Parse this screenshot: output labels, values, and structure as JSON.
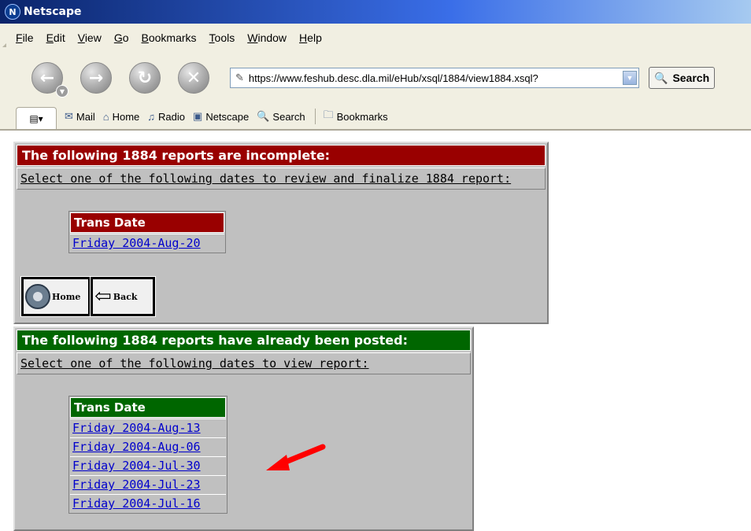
{
  "window": {
    "title": "Netscape",
    "app_icon": "N"
  },
  "menu": [
    "File",
    "Edit",
    "View",
    "Go",
    "Bookmarks",
    "Tools",
    "Window",
    "Help"
  ],
  "navbar": {
    "url": "https://www.feshub.desc.dla.mil/eHub/xsql/1884/view1884.xsql?",
    "search_label": "Search"
  },
  "personal_toolbar": {
    "items": [
      "Mail",
      "Home",
      "Radio",
      "Netscape",
      "Search",
      "Bookmarks"
    ]
  },
  "incomplete": {
    "heading": "The following 1884 reports are incomplete:",
    "instruction": "Select one of the following dates to review and finalize 1884 report:",
    "table_header": "Trans Date",
    "dates": [
      "Friday 2004-Aug-20"
    ],
    "buttons": {
      "home": "Home",
      "back": "Back"
    }
  },
  "posted": {
    "heading": "The following 1884 reports have already been posted:",
    "instruction": "Select one of the following dates to view report:",
    "table_header": "Trans Date",
    "dates": [
      "Friday 2004-Aug-13",
      "Friday 2004-Aug-06",
      "Friday 2004-Jul-30",
      "Friday 2004-Jul-23",
      "Friday 2004-Jul-16"
    ]
  },
  "colors": {
    "incomplete_header": "#990000",
    "posted_header": "#006600",
    "link": "#0000cc",
    "annotation_arrow": "#ff0000"
  }
}
